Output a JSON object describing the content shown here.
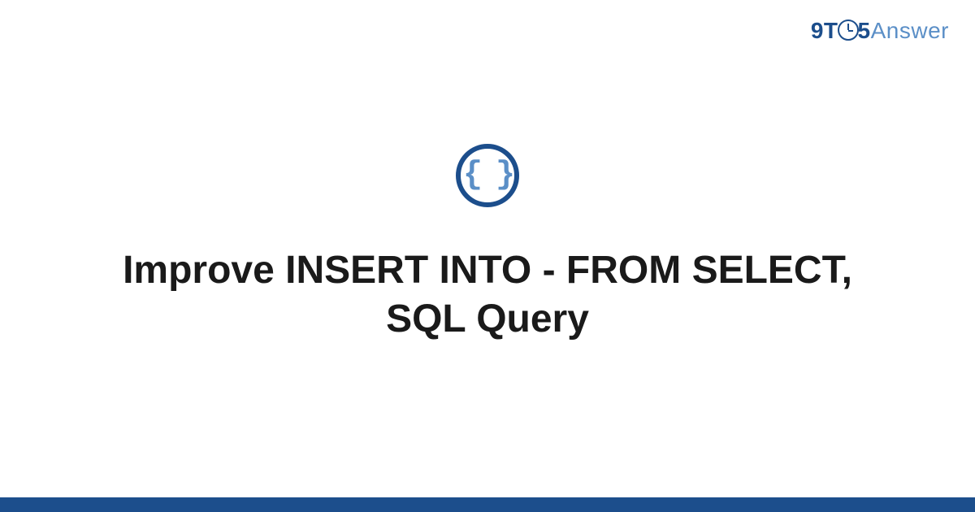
{
  "logo": {
    "part1": "9T",
    "part2": "5",
    "part3": "Answer"
  },
  "icon": {
    "braces": "{ }"
  },
  "title": "Improve INSERT INTO - FROM SELECT, SQL Query"
}
